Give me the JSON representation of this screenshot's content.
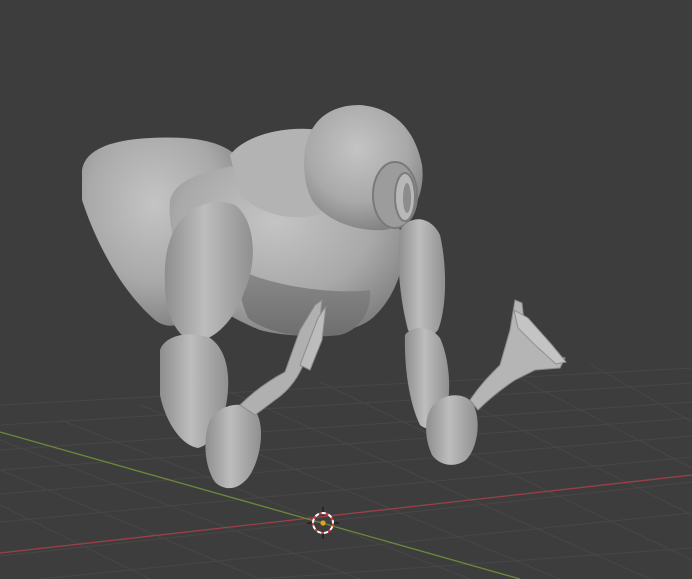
{
  "viewport": {
    "background_color": "#3d3d3d",
    "grid_line_color": "#4a4a4a",
    "x_axis_color": "#9a4048",
    "y_axis_color": "#6a8a3a",
    "model_color": "#a8a8a8",
    "cursor_icon": "3d-cursor-icon",
    "origin_color": "#e8a020"
  }
}
